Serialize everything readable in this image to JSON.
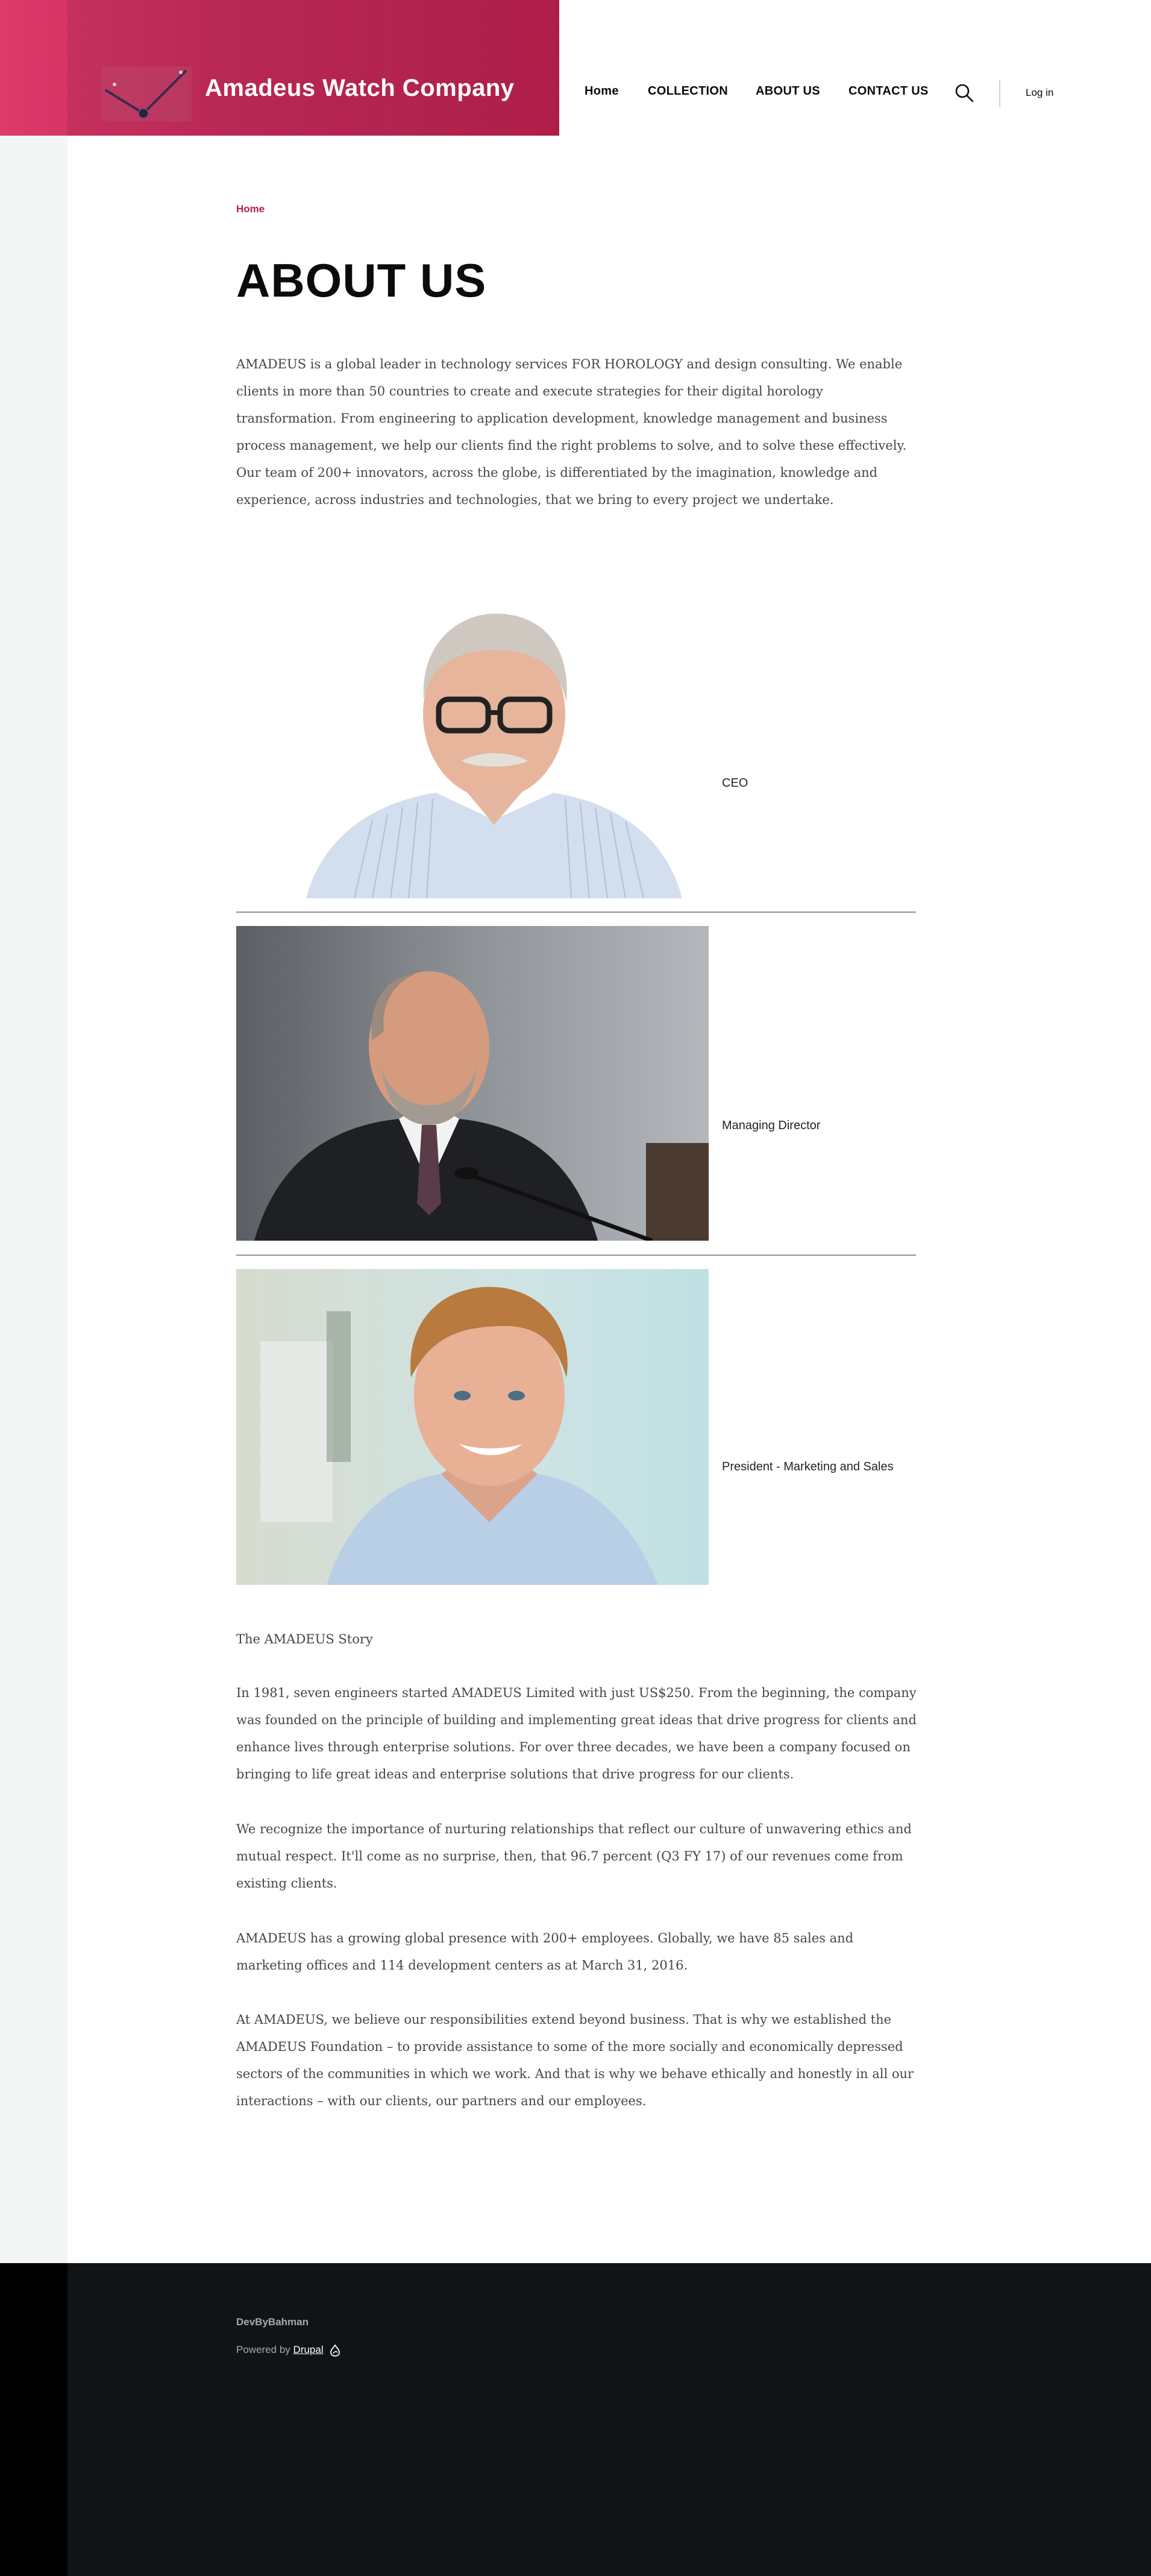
{
  "header": {
    "site_name": "Amadeus Watch Company",
    "nav": [
      "Home",
      "COLLECTION",
      "ABOUT US",
      "CONTACT US"
    ],
    "login_label": "Log in",
    "icons": [
      "clock-logo-icon",
      "search-icon"
    ],
    "brand_colors": [
      "#de3a6b",
      "#b21f4b"
    ]
  },
  "breadcrumb": {
    "home": "Home"
  },
  "page": {
    "title": "ABOUT US",
    "intro": "AMADEUS is a global leader in technology services FOR HOROLOGY and design consulting. We enable clients in more than 50 countries to create and execute strategies for their digital horology transformation. From engineering to application development, knowledge management and business process management, we help our clients find the right problems to solve, and to solve these effectively. Our team of 200+ innovators, across the globe, is differentiated by the imagination, knowledge and experience, across industries and technologies, that we bring to every project we undertake."
  },
  "team": [
    {
      "role": "CEO"
    },
    {
      "role": "Managing Director"
    },
    {
      "role": "President - Marketing and Sales"
    }
  ],
  "story": {
    "heading": "The AMADEUS Story",
    "paragraphs": [
      "In 1981, seven engineers started AMADEUS Limited with just US$250. From the beginning, the company was founded on the principle of building and implementing great ideas that drive progress for clients and enhance lives through enterprise solutions. For over three decades, we have been a company focused on bringing to life great ideas and enterprise solutions that drive progress for our clients.",
      "We recognize the importance of nurturing relationships that reflect our culture of unwavering ethics and mutual respect. It'll come as no surprise, then, that 96.7 percent (Q3 FY 17) of our revenues come from existing clients.",
      "AMADEUS has a growing global presence with 200+ employees. Globally, we have 85 sales and marketing offices and 114 development centers as at March 31, 2016.",
      "At AMADEUS, we believe our responsibilities extend beyond business. That is why we established the AMADEUS Foundation – to provide assistance to some of the more socially and economically depressed sectors of the communities in which we work. And that is why we behave ethically and honestly in all our interactions – with our clients, our partners and our employees."
    ]
  },
  "footer": {
    "brand": "DevByBahman",
    "powered_by": "Powered by",
    "drupal_link": "Drupal",
    "icons": [
      "drupal-drop-icon"
    ]
  }
}
